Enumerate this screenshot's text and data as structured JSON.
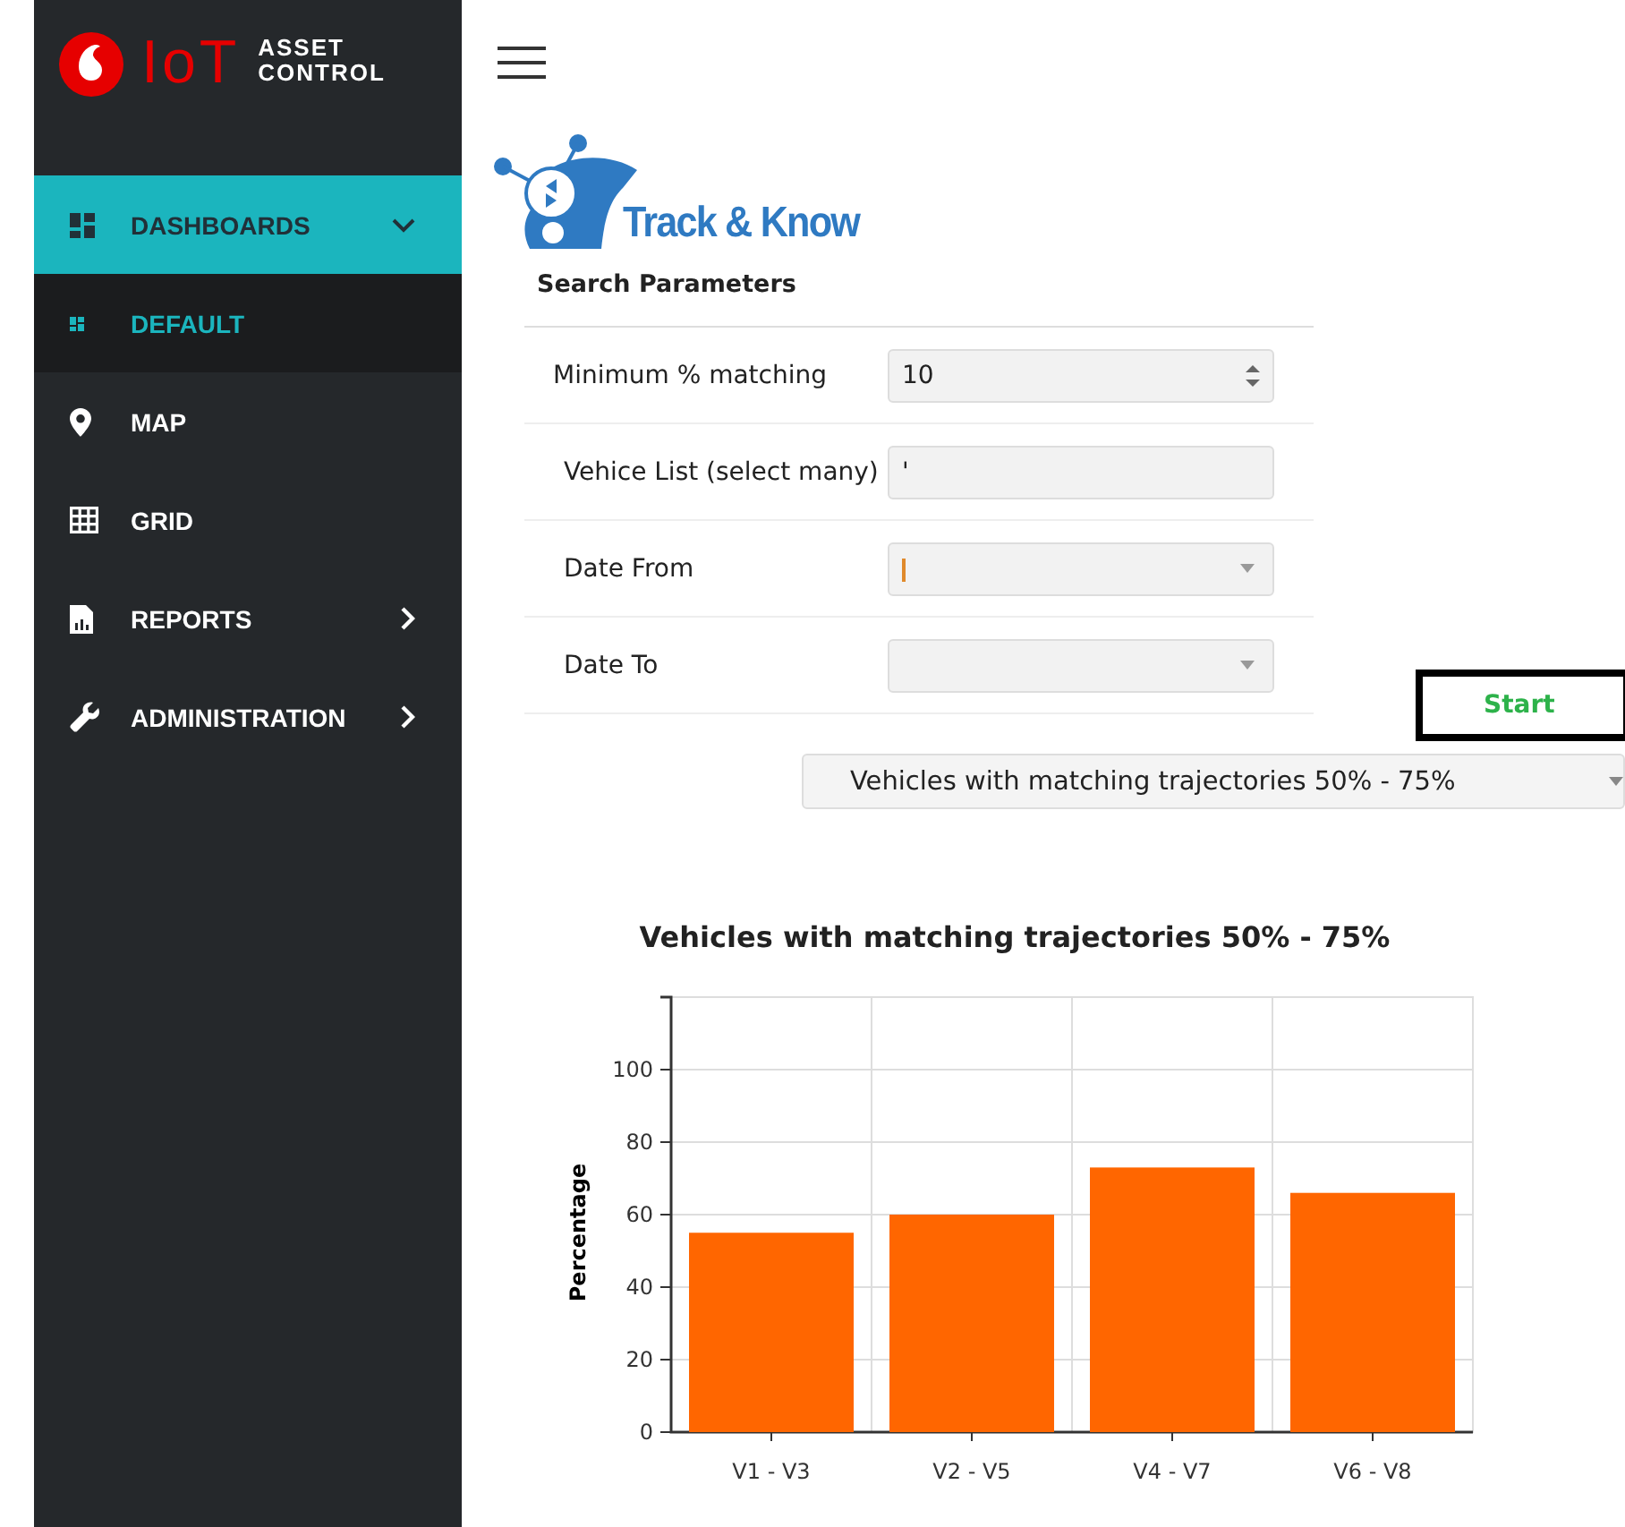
{
  "brand": {
    "iot": "IoT",
    "line_1": "ASSET",
    "line_2": "CONTROL"
  },
  "sidebar": {
    "items": [
      {
        "label": "DASHBOARDS",
        "selected": true,
        "expanded": true,
        "children": [
          {
            "label": "DEFAULT",
            "selected": true
          }
        ]
      },
      {
        "label": "MAP",
        "selected": false
      },
      {
        "label": "GRID",
        "selected": false
      },
      {
        "label": "REPORTS",
        "selected": false,
        "expanded": false
      },
      {
        "label": "ADMINISTRATION",
        "selected": false,
        "expanded": false
      }
    ]
  },
  "header": {
    "logo_text": "Track & Know"
  },
  "search": {
    "title": "Search Parameters",
    "fields": [
      {
        "label": "Minimum % matching",
        "kind": "number",
        "value": "10"
      },
      {
        "label": "Vehice List (select many)",
        "kind": "text",
        "value": "'"
      },
      {
        "label": "Date From",
        "kind": "date",
        "focused": true
      },
      {
        "label": "Date To",
        "kind": "date",
        "focused": false
      }
    ],
    "start_button": "Start"
  },
  "result_select": {
    "value": "Vehicles with matching trajectories 50% - 75%"
  },
  "chart": {
    "chart_data": {
      "type": "bar",
      "title": "Vehicles with matching trajectories 50% - 75%",
      "ylabel": "Percentage",
      "categories": [
        "V1 - V3",
        "V2 - V5",
        "V4 - V7",
        "V6 - V8"
      ],
      "series": [
        {
          "color": "#ff6600",
          "values": [
            55,
            60,
            73,
            66
          ]
        }
      ],
      "grid": true,
      "ylim": [
        0,
        120
      ],
      "yticks": [
        0,
        20,
        40,
        60,
        80,
        100
      ]
    }
  }
}
